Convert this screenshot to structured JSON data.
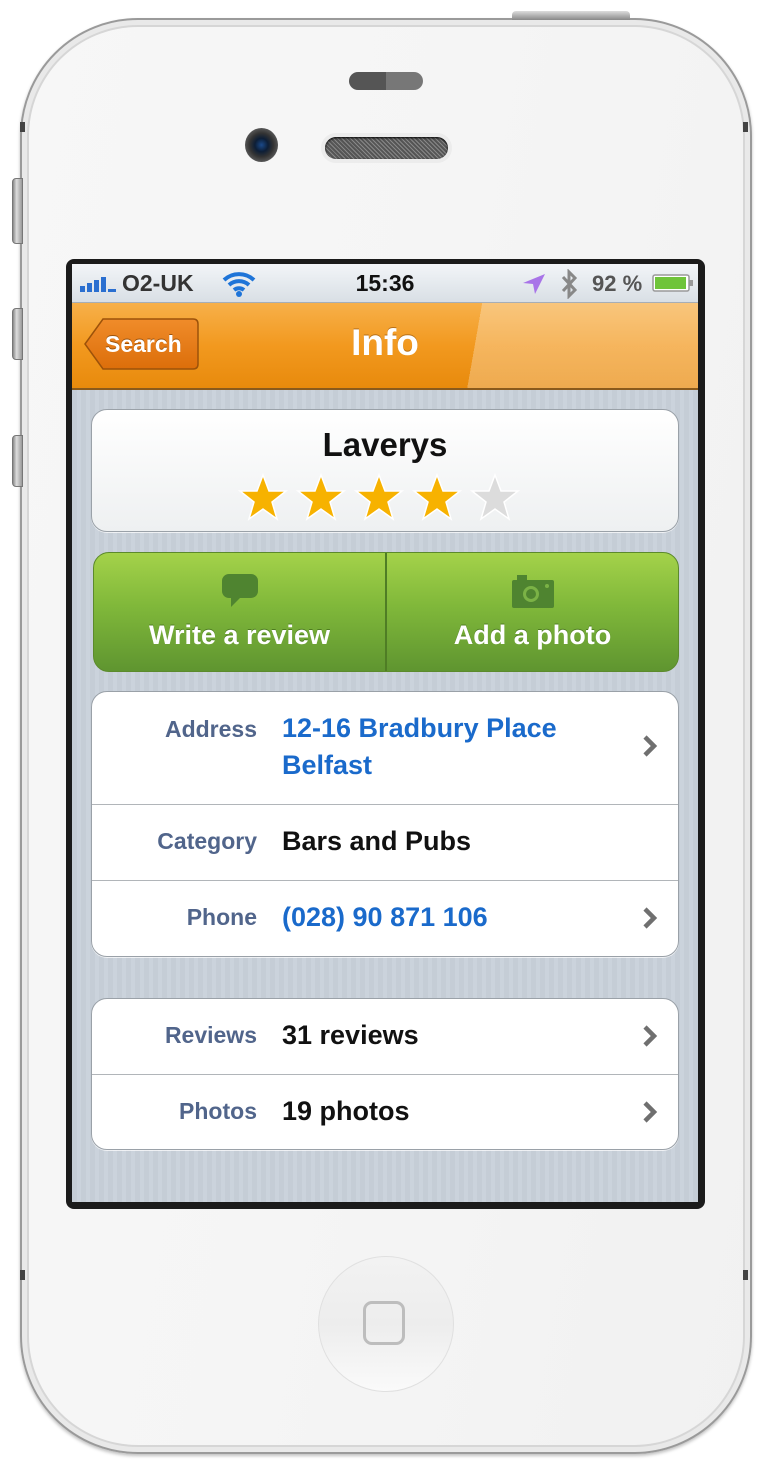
{
  "status_bar": {
    "carrier": "O2-UK",
    "time": "15:36",
    "battery_percent": "92 %",
    "signal_bars": 5,
    "icons": [
      "signal-icon",
      "wifi-icon",
      "location-arrow-icon",
      "bluetooth-icon",
      "battery-icon"
    ]
  },
  "nav": {
    "back_label": "Search",
    "title": "Info"
  },
  "place": {
    "name": "Laverys",
    "rating": 4,
    "rating_max": 5
  },
  "actions": [
    {
      "label": "Write a review",
      "icon": "speech-bubble-icon"
    },
    {
      "label": "Add a photo",
      "icon": "camera-icon"
    }
  ],
  "info_rows": [
    {
      "label": "Address",
      "value_line1": "12-16 Bradbury Place",
      "value_line2": "Belfast",
      "link": true
    },
    {
      "label": "Category",
      "value": "Bars and Pubs",
      "link": false
    },
    {
      "label": "Phone",
      "value": "(028) 90 871 106",
      "link": true
    }
  ],
  "link_rows": [
    {
      "label": "Reviews",
      "value": "31 reviews"
    },
    {
      "label": "Photos",
      "value": "19 photos"
    }
  ],
  "colors": {
    "nav_orange": "#f2991f",
    "action_green": "#80b83a",
    "label_blue_gray": "#51658b",
    "link_blue": "#1a6acb",
    "star_filled": "#f7b200",
    "star_empty": "#dcdcdc"
  }
}
